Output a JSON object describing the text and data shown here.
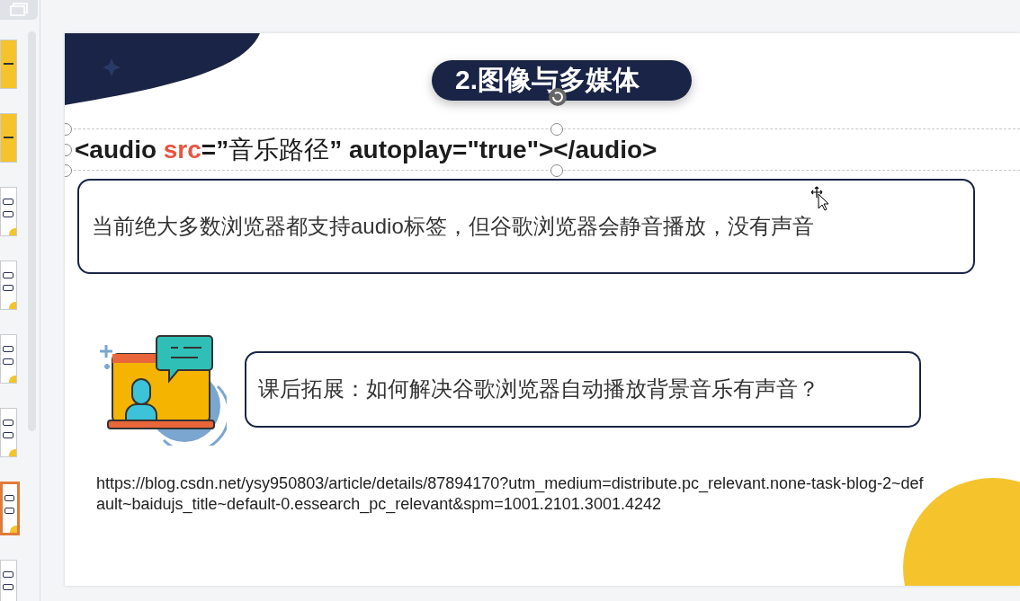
{
  "thumbnails": [
    {
      "kind": "cover",
      "selected": false
    },
    {
      "kind": "cover",
      "selected": false
    },
    {
      "kind": "content",
      "selected": false
    },
    {
      "kind": "content",
      "selected": false
    },
    {
      "kind": "content",
      "selected": false
    },
    {
      "kind": "content",
      "selected": false
    },
    {
      "kind": "content",
      "selected": true
    },
    {
      "kind": "content",
      "selected": false
    }
  ],
  "slide": {
    "title": "2.图像与多媒体",
    "code_line": [
      {
        "text": "<audio ",
        "kind": "code"
      },
      {
        "text": "src",
        "kind": "attr"
      },
      {
        "text": "=”",
        "kind": "code"
      },
      {
        "text": "音乐路径",
        "kind": "cjk"
      },
      {
        "text": "” autoplay=\"true\"></audio>",
        "kind": "code"
      }
    ],
    "note": "当前绝大多数浏览器都支持audio标签，但谷歌浏览器会静音播放，没有声音",
    "question": "课后拓展：如何解决谷歌浏览器自动播放背景音乐有声音？",
    "link": "https://blog.csdn.net/ysy950803/article/details/87894170?utm_medium=distribute.pc_relevant.none-task-blog-2~default~baidujs_title~default-0.essearch_pc_relevant&spm=1001.2101.3001.4242"
  }
}
